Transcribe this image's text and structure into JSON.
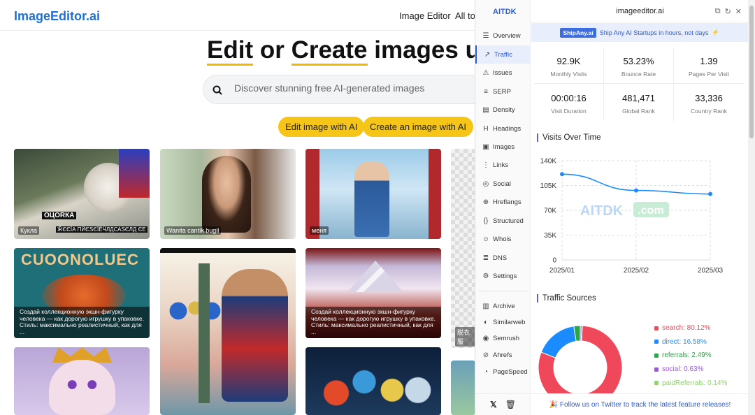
{
  "site": {
    "logo": "ImageEditor.ai",
    "nav": [
      "Image Editor",
      "All to"
    ],
    "hero_words": [
      "Edit",
      " or ",
      "Create",
      " images us"
    ],
    "search_placeholder": "Discover stunning free AI-generated images",
    "btn_edit": "Edit image with AI",
    "btn_create": "Create an image with AI",
    "captions": [
      "Кукла",
      "Wanita cantik bugil",
      "меня",
      "Создай коллекционную экшн-фигурку человека — как дорогую игрушку в упаковке. Стиль: максимально реалистичный, как для ...",
      "Создай коллекционную экшн-фигурку человека — как дорогую игрушку в упаковке. Стиль: максимально реалистичный, как для ...",
      "脱衣服"
    ],
    "img1_text": "ОЦОRКА",
    "img1_sub": "ӁЄЄЇА ПӢЄЅЄЇЁӴЛДСАЅЄЛД ЄЕ",
    "img4_text": "СUOONOLUEC"
  },
  "ext": {
    "brand": "AITDK",
    "domain": "imageeditor.ai",
    "sidebar": [
      {
        "icon": "☰",
        "label": "Overview"
      },
      {
        "icon": "↗",
        "label": "Traffic"
      },
      {
        "icon": "⚠",
        "label": "Issues"
      },
      {
        "icon": "≡",
        "label": "SERP"
      },
      {
        "icon": "▤",
        "label": "Density"
      },
      {
        "icon": "H",
        "label": "Headings"
      },
      {
        "icon": "▣",
        "label": "Images"
      },
      {
        "icon": "⋮",
        "label": "Links"
      },
      {
        "icon": "◎",
        "label": "Social"
      },
      {
        "icon": "⊕",
        "label": "Hreflangs"
      },
      {
        "icon": "{}",
        "label": "Structured"
      },
      {
        "icon": "☺",
        "label": "Whois"
      },
      {
        "icon": "≣",
        "label": "DNS"
      },
      {
        "icon": "⚙",
        "label": "Settings"
      },
      {
        "icon": "▥",
        "label": "Archive"
      },
      {
        "icon": "◐",
        "label": "Similarweb"
      },
      {
        "icon": "◉",
        "label": "Semrush"
      },
      {
        "icon": "⊘",
        "label": "Ahrefs"
      },
      {
        "icon": "◔",
        "label": "PageSpeed"
      }
    ],
    "promo_badge": "ShipAny.ai",
    "promo_text": "Ship Any AI Startups in hours, not days",
    "stats": [
      {
        "value": "92.9K",
        "label": "Monthly Visits"
      },
      {
        "value": "53.23%",
        "label": "Bounce Rate"
      },
      {
        "value": "1.39",
        "label": "Pages Per Visit"
      },
      {
        "value": "00:00:16",
        "label": "Visit Duration"
      },
      {
        "value": "481,471",
        "label": "Global Rank"
      },
      {
        "value": "33,336",
        "label": "Country Rank"
      }
    ],
    "visits_title": "Visits Over Time",
    "watermark": "AITDK",
    "watermark_tld": ".com",
    "sources_title": "Traffic Sources",
    "footer": "🎉 Follow us on Twitter to track the latest feature releases!"
  },
  "chart_data": [
    {
      "type": "line",
      "title": "Visits Over Time",
      "x": [
        "2025/01",
        "2025/02",
        "2025/03"
      ],
      "y_ticks": [
        "0",
        "35K",
        "70K",
        "105K",
        "140K"
      ],
      "ylim": [
        0,
        140000
      ],
      "series": [
        {
          "values": [
            121000,
            98000,
            93000
          ]
        }
      ],
      "color": "#1a8cff"
    },
    {
      "type": "pie",
      "title": "Traffic Sources",
      "labels": [
        "search: 80.12%",
        "direct: 16.58%",
        "referrals: 2.49%",
        "social: 0.63%",
        "paidReferrals: 0.14%"
      ],
      "values": [
        80.12,
        16.58,
        2.49,
        0.63,
        0.14
      ],
      "colors": [
        "#f0485b",
        "#1a8cff",
        "#27a844",
        "#9b59d6",
        "#8cd66a"
      ]
    }
  ]
}
